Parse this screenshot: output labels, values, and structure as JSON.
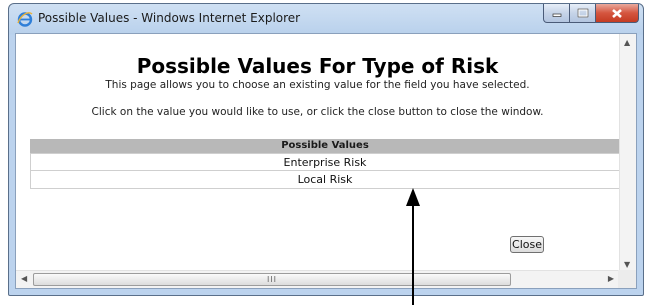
{
  "window": {
    "title": "Possible Values - Windows Internet Explorer"
  },
  "page": {
    "heading": "Possible Values For Type of Risk",
    "line1": "This page allows you to choose an existing value for the field you have selected.",
    "line2": "Click on the value you would like to use, or click the close button to close the window."
  },
  "table": {
    "header": "Possible Values",
    "rows": [
      "Enterprise Risk",
      "Local Risk"
    ]
  },
  "buttons": {
    "close_label": "Close",
    "scroll_grip": "III"
  },
  "colors": {
    "titlebar": "#b9d1ec",
    "table_header": "#b8b8b8",
    "close_caption": "#d5553f"
  }
}
